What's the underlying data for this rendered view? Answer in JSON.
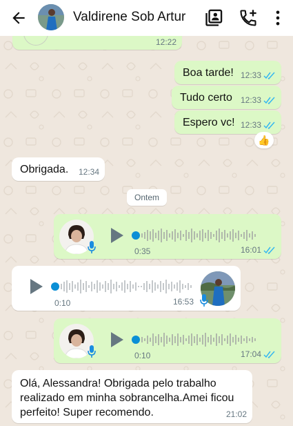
{
  "header": {
    "contact_name": "Valdirene Sob Artur",
    "icons": [
      "back-arrow-icon",
      "contact-avatar",
      "contacts-card-icon",
      "add-call-icon",
      "more-vert-icon"
    ]
  },
  "colors": {
    "outgoing_bubble": "#dcf8c6",
    "incoming_bubble": "#ffffff",
    "chat_background": "#efe7de",
    "read_ticks": "#34b7f1",
    "audio_dot": "#0b8fd6"
  },
  "messages": [
    {
      "dir": "out",
      "text": "",
      "time": "12:22",
      "status": "partial"
    },
    {
      "dir": "out",
      "text": "Boa tarde!",
      "time": "12:33",
      "status": "read"
    },
    {
      "dir": "out",
      "text": "Tudo certo",
      "time": "12:33",
      "status": "read"
    },
    {
      "dir": "out",
      "text": "Espero vc!",
      "time": "12:33",
      "status": "read",
      "reaction": "👍"
    },
    {
      "dir": "in",
      "text": "Obrigada.",
      "time": "12:34"
    },
    {
      "dir": "out",
      "type": "voice",
      "duration": "0:35",
      "time": "16:01",
      "status": "read"
    },
    {
      "dir": "in",
      "type": "voice",
      "duration": "0:10",
      "time": "16:53"
    },
    {
      "dir": "out",
      "type": "voice",
      "duration": "0:10",
      "time": "17:04",
      "status": "read"
    },
    {
      "dir": "in",
      "lines": [
        "Olá, Alessandra! Obrigada pelo trabalho",
        "realizado em minha sobrancelha.Amei ficou",
        "perfeito! Super recomendo."
      ],
      "time": "21:02"
    }
  ],
  "date_divider": "Ontem"
}
